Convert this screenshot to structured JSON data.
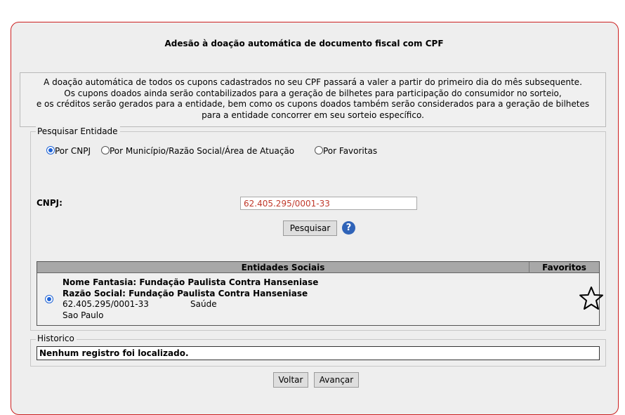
{
  "page": {
    "title": "Adesão à doação automática de documento fiscal com CPF",
    "notice_lines": [
      "A doação automática de todos os cupons cadastrados no seu CPF passará a valer a partir do primeiro dia do mês subsequente.",
      "Os cupons doados ainda serão contabilizados para a geração de bilhetes para participação do consumidor no sorteio,",
      "e os créditos serão gerados para a entidade, bem como os cupons doados também serão considerados para a geração de bilhetes",
      "para a entidade concorrer em seu sorteio específico."
    ]
  },
  "search": {
    "legend": "Pesquisar Entidade",
    "options": [
      {
        "label": "Por CNPJ",
        "selected": true
      },
      {
        "label": "Por Município/Razão Social/Área de Atuação",
        "selected": false
      },
      {
        "label": "Por Favoritas",
        "selected": false
      }
    ],
    "cnpj_label": "CNPJ:",
    "cnpj_value": "62.405.295/0001-33",
    "search_button": "Pesquisar",
    "help_icon": "help-circle-icon"
  },
  "results": {
    "header_main": "Entidades Sociais",
    "header_fav": "Favoritos",
    "rows": [
      {
        "nome_fantasia": "Nome Fantasia: Fundação Paulista Contra Hanseniase",
        "razao_social": "Razão Social: Fundação Paulista Contra Hanseniase",
        "cnpj": "62.405.295/0001-33",
        "area": "Saúde",
        "cidade": "Sao Paulo",
        "selected": true,
        "favorite_icon": "star-outline-icon"
      }
    ]
  },
  "history": {
    "legend": "Historico",
    "message": "Nenhum registro foi localizado."
  },
  "actions": {
    "back": "Voltar",
    "next": "Avançar"
  },
  "colors": {
    "panel_border": "#cc1f1f",
    "radio_selected": "#1e63d6",
    "cnpj_text": "#c0392b",
    "help_icon": "#2f63b8"
  }
}
